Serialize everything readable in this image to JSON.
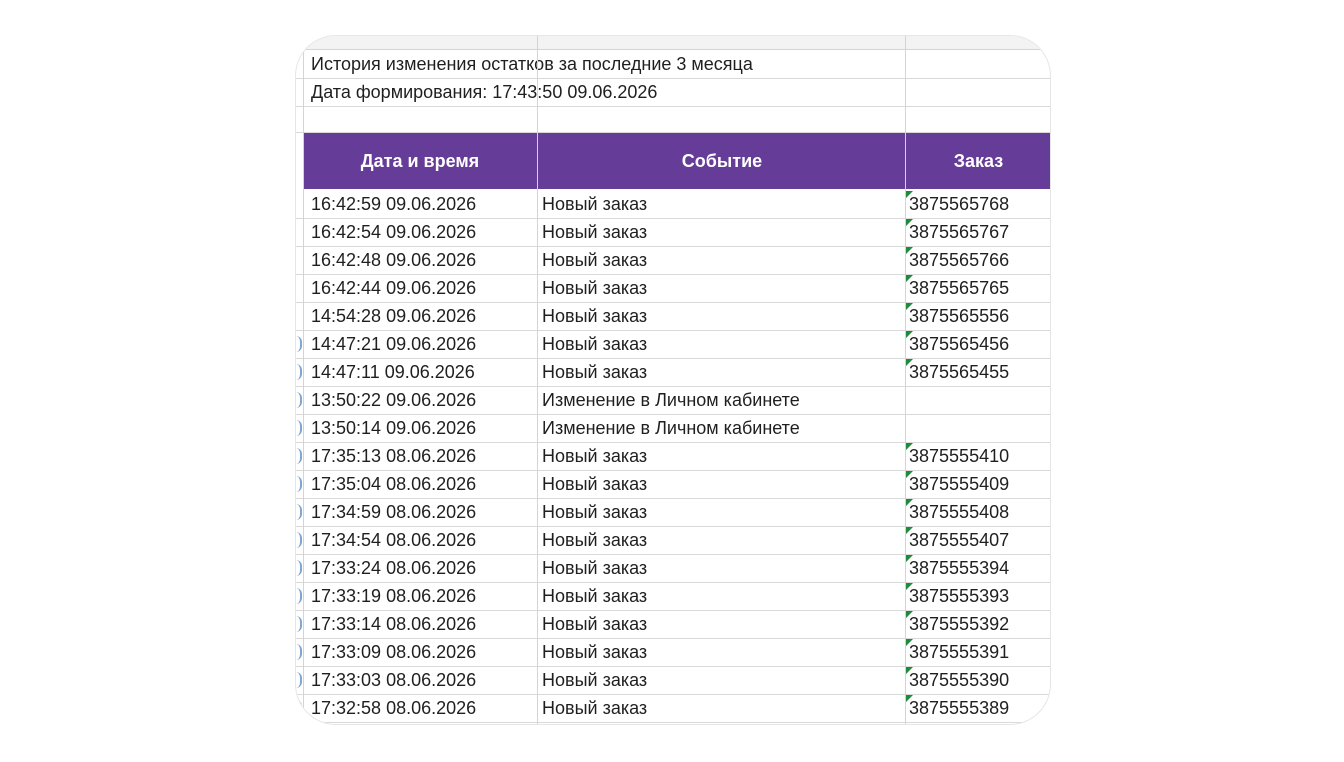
{
  "report": {
    "title": "История изменения остатков за последние 3 месяца",
    "generated": "Дата формирования: 17:43:50 09.06.2026"
  },
  "table": {
    "headers": [
      "Дата и время",
      "Событие",
      "Заказ"
    ],
    "header_bg": "#663c99",
    "order_flag_color": "#1f8a3a",
    "rows": [
      {
        "datetime": "16:42:59 09.06.2026",
        "event": "Новый заказ",
        "order": "3875565768"
      },
      {
        "datetime": "16:42:54 09.06.2026",
        "event": "Новый заказ",
        "order": "3875565767"
      },
      {
        "datetime": "16:42:48 09.06.2026",
        "event": "Новый заказ",
        "order": "3875565766"
      },
      {
        "datetime": "16:42:44 09.06.2026",
        "event": "Новый заказ",
        "order": "3875565765"
      },
      {
        "datetime": "14:54:28 09.06.2026",
        "event": "Новый заказ",
        "order": "3875565556"
      },
      {
        "datetime": "14:47:21 09.06.2026",
        "event": "Новый заказ",
        "order": "3875565456"
      },
      {
        "datetime": "14:47:11 09.06.2026",
        "event": "Новый заказ",
        "order": "3875565455"
      },
      {
        "datetime": "13:50:22 09.06.2026",
        "event": "Изменение в Личном кабинете",
        "order": ""
      },
      {
        "datetime": "13:50:14 09.06.2026",
        "event": "Изменение в Личном кабинете",
        "order": ""
      },
      {
        "datetime": "17:35:13 08.06.2026",
        "event": "Новый заказ",
        "order": "3875555410"
      },
      {
        "datetime": "17:35:04 08.06.2026",
        "event": "Новый заказ",
        "order": "3875555409"
      },
      {
        "datetime": "17:34:59 08.06.2026",
        "event": "Новый заказ",
        "order": "3875555408"
      },
      {
        "datetime": "17:34:54 08.06.2026",
        "event": "Новый заказ",
        "order": "3875555407"
      },
      {
        "datetime": "17:33:24 08.06.2026",
        "event": "Новый заказ",
        "order": "3875555394"
      },
      {
        "datetime": "17:33:19 08.06.2026",
        "event": "Новый заказ",
        "order": "3875555393"
      },
      {
        "datetime": "17:33:14 08.06.2026",
        "event": "Новый заказ",
        "order": "3875555392"
      },
      {
        "datetime": "17:33:09 08.06.2026",
        "event": "Новый заказ",
        "order": "3875555391"
      },
      {
        "datetime": "17:33:03 08.06.2026",
        "event": "Новый заказ",
        "order": "3875555390"
      },
      {
        "datetime": "17:32:58 08.06.2026",
        "event": "Новый заказ",
        "order": "3875555389"
      }
    ]
  }
}
